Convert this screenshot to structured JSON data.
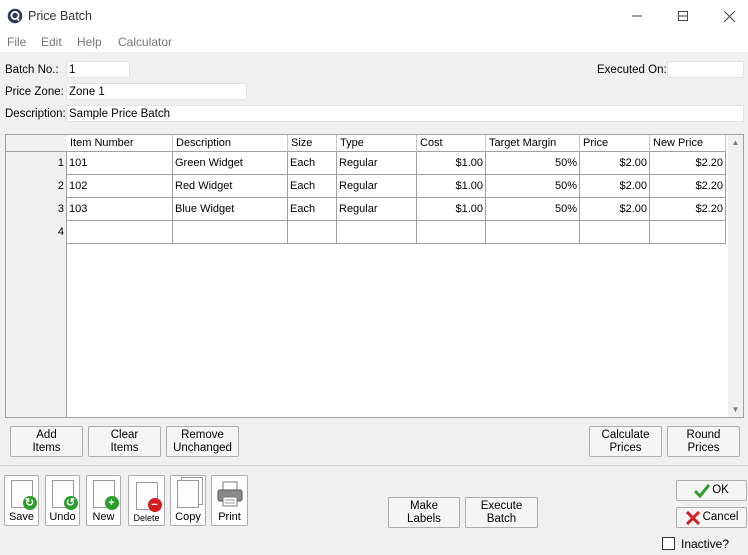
{
  "window": {
    "title": "Price Batch",
    "minimize": "—",
    "maximize": "☐",
    "close": "✕"
  },
  "menu": {
    "file": "File",
    "edit": "Edit",
    "help": "Help",
    "calculator": "Calculator"
  },
  "header": {
    "batch_label": "Batch No.:",
    "batch_value": "1",
    "zone_label": "Price Zone:",
    "zone_value": "Zone 1",
    "desc_label": "Description:",
    "desc_value": "Sample Price Batch",
    "executed_label": "Executed On:",
    "executed_value": ""
  },
  "grid": {
    "columns": [
      "Item Number",
      "Description",
      "Size",
      "Type",
      "Cost",
      "Target Margin",
      "Price",
      "New Price"
    ],
    "row_numbers": [
      "1",
      "2",
      "3",
      "4"
    ],
    "rows": [
      [
        "101",
        "Green Widget",
        "Each",
        "Regular",
        "$1.00",
        "50%",
        "$2.00",
        "$2.20"
      ],
      [
        "102",
        "Red Widget",
        "Each",
        "Regular",
        "$1.00",
        "50%",
        "$2.00",
        "$2.20"
      ],
      [
        "103",
        "Blue Widget",
        "Each",
        "Regular",
        "$1.00",
        "50%",
        "$2.00",
        "$2.20"
      ],
      [
        "",
        "",
        "",
        "",
        "",
        "",
        "",
        ""
      ]
    ]
  },
  "actions": {
    "add_items_1": "Add",
    "add_items_2": "Items",
    "clear_items_1": "Clear",
    "clear_items_2": "Items",
    "remove_1": "Remove",
    "remove_2": "Unchanged",
    "calc_1": "Calculate",
    "calc_2": "Prices",
    "round_1": "Round",
    "round_2": "Prices"
  },
  "toolbar": {
    "save": "Save",
    "undo": "Undo",
    "new": "New",
    "delete": "Delete",
    "copy": "Copy",
    "print": "Print"
  },
  "bottom": {
    "make_1": "Make",
    "make_2": "Labels",
    "exec_1": "Execute",
    "exec_2": "Batch",
    "ok": "OK",
    "cancel": "Cancel",
    "inactive": "Inactive?"
  },
  "colors": {
    "ok_check": "#2e9e2e",
    "cancel_x": "#d42020",
    "save_badge": "#2a9d2a",
    "delete_badge": "#d02020"
  }
}
